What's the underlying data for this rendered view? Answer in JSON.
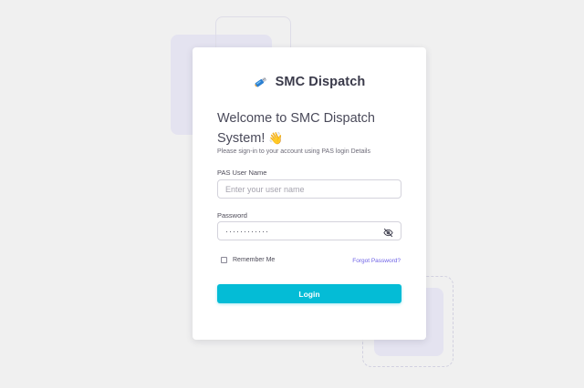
{
  "brand": {
    "name": "SMC Dispatch",
    "logo_icon": "usb-drive-icon",
    "accent_color": "#04bcd6"
  },
  "welcome": {
    "title": "Welcome to SMC Dispatch System!",
    "wave_icon": "waving-hand-icon",
    "subtitle": "Please sign-in to your account using PAS login Details"
  },
  "form": {
    "username_label": "PAS User Name",
    "username_placeholder": "Enter your user name",
    "username_value": "",
    "password_label": "Password",
    "password_value": "············",
    "password_toggle_icon": "eye-off-icon",
    "remember_label": "Remember Me",
    "remember_checked": false,
    "forgot_link": "Forgot Password?",
    "forgot_color": "#6e62e6",
    "login_label": "Login"
  }
}
